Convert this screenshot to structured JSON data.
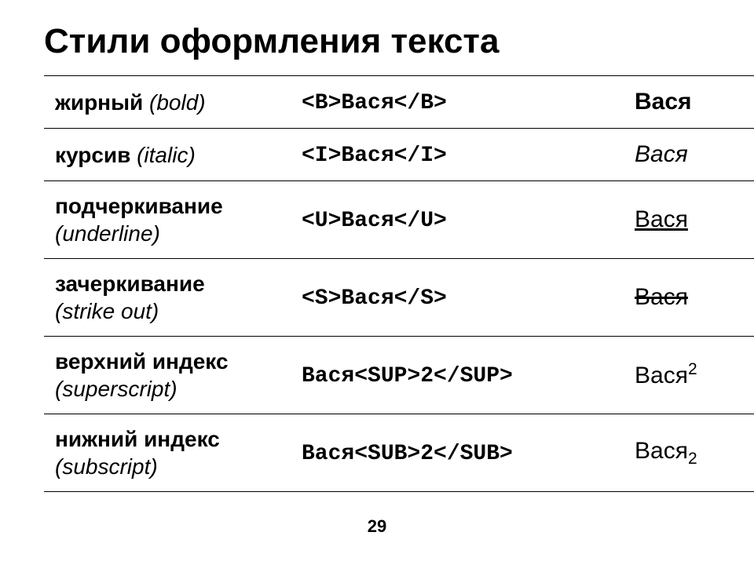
{
  "title": "Стили оформления текста",
  "page_number": "29",
  "sample_word": "Вася",
  "sample_num": "2",
  "rows": [
    {
      "desc_ru": "жирный",
      "desc_en": " (bold)",
      "code": "<B>Вася</B>",
      "result_base": "Вася",
      "result_suffix": "",
      "style": "bold"
    },
    {
      "desc_ru": "курсив",
      "desc_en": " (italic)",
      "code": "<I>Вася</I>",
      "result_base": "Вася",
      "result_suffix": "",
      "style": "italic"
    },
    {
      "desc_ru": "подчеркивание",
      "desc_en": "(underline)",
      "code": "<U>Вася</U>",
      "result_base": "Вася",
      "result_suffix": "",
      "style": "underline"
    },
    {
      "desc_ru": "зачеркивание",
      "desc_en": "(strike out)",
      "code": "<S>Вася</S>",
      "result_base": "Вася",
      "result_suffix": "",
      "style": "strike"
    },
    {
      "desc_ru": "верхний индекс",
      "desc_en": "(superscript)",
      "code": "Вася<SUP>2</SUP>",
      "result_base": "Вася",
      "result_suffix": "2",
      "style": "sup"
    },
    {
      "desc_ru": "нижний индекс",
      "desc_en": "(subscript)",
      "code": "Вася<SUB>2</SUB>",
      "result_base": "Вася",
      "result_suffix": "2",
      "style": "sub"
    }
  ]
}
